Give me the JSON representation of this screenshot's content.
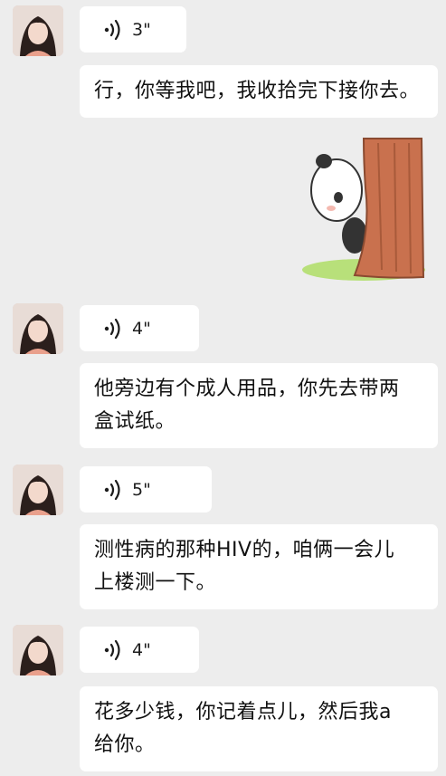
{
  "messages": [
    {
      "type": "voice",
      "duration": "3\""
    },
    {
      "type": "text",
      "lines": [
        "行，你等我吧，我收拾完下接你去。"
      ]
    },
    {
      "type": "sticker",
      "icon": "panda-behind-curtain-sticker"
    },
    {
      "type": "voice",
      "duration": "4\""
    },
    {
      "type": "text",
      "lines": [
        "他旁边有个成人用品，你先去带两",
        "盒试纸。"
      ]
    },
    {
      "type": "voice",
      "duration": "5\""
    },
    {
      "type": "text",
      "lines": [
        "测性病的那种HIV的，咱俩一会儿",
        "上楼测一下。"
      ]
    },
    {
      "type": "voice",
      "duration": "4\""
    },
    {
      "type": "text",
      "lines": [
        "花多少钱，你记着点儿，然后我a",
        "给你。"
      ]
    }
  ],
  "colors": {
    "background": "#ededed",
    "bubble": "#ffffff",
    "text": "#111111"
  }
}
